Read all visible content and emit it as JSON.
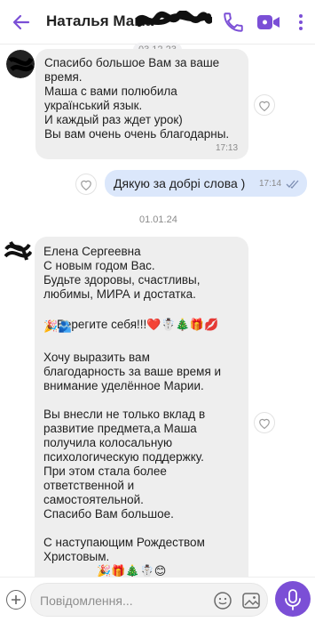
{
  "header": {
    "title": "Наталья Мама",
    "accent_color": "#7b4fd6"
  },
  "dates": {
    "first": "03.12.23",
    "second": "01.01.24"
  },
  "messages": [
    {
      "text": "Спасибо большое Вам за ваше\nвремя.\nМаша с вами полюбила\nукраїнський язык.\nИ каждый раз ждет урок)\nВы вам очень очень благодарны.",
      "time": "17:13"
    },
    {
      "text": "Дякую за добрі слова )",
      "time": "17:14"
    },
    {
      "text": "Елена Сергеевна\nС новым годом Вас.\nБудьте здоровы, счастливы,\nлюбимы, МИРА и достатка.",
      "emoji_line_text": "Берегите себя!!!",
      "emojis_line1": "❤️☃️🎄🎁💋",
      "emojis_line2": "🎉🫂",
      "text2": "Хочу выразить вам\nблагодарность за ваше время и\nвнимание уделённое Марии.\n\nВы внесли не только вклад в\nразвитие предмета,а Маша\nполучила колосальную\nпсихологическую поддержку.\nПри этом стала более\nответственной и\nсамостоятельной.\nСпасибо Вам большое.\n\nС наступающим Рождеством\nХристовым.",
      "partial_emojis": "🎉🎁🎄☃️😊"
    }
  ],
  "composer": {
    "placeholder": "Повідомлення..."
  }
}
